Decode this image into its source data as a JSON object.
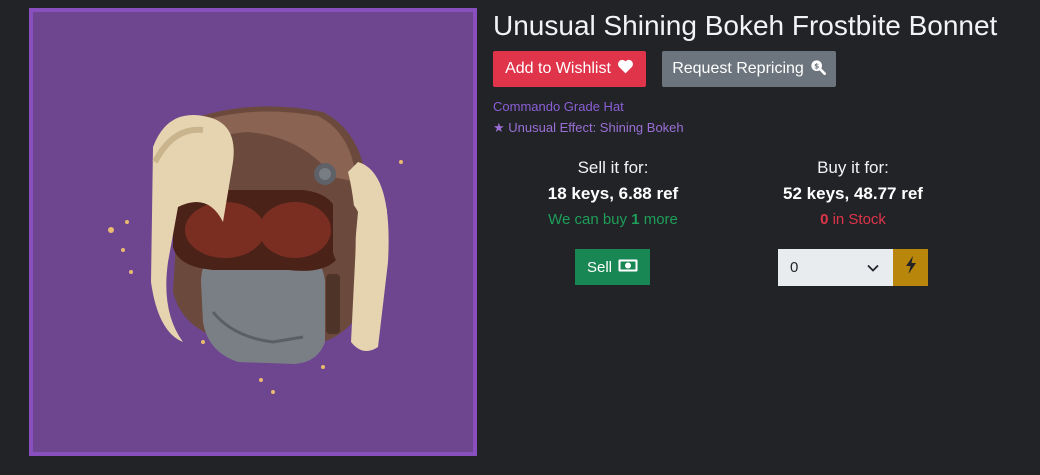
{
  "item": {
    "title": "Unusual Shining Bokeh Frostbite Bonnet",
    "grade": "Commando Grade Hat",
    "effect": "★ Unusual Effect: Shining Bokeh",
    "image_icon": "frostbite-bonnet-hat-image"
  },
  "actions": {
    "wishlist_label": "Add to Wishlist",
    "wishlist_icon": "heart-icon",
    "reprice_label": "Request Repricing",
    "reprice_icon": "search-dollar-icon"
  },
  "sell": {
    "label": "Sell it for:",
    "price": "18 keys, 6.88 ref",
    "note_prefix": "We can buy ",
    "note_count": "1",
    "note_suffix": " more",
    "button_label": "Sell",
    "button_icon": "money-bill-icon"
  },
  "buy": {
    "label": "Buy it for:",
    "price": "52 keys, 48.77 ref",
    "stock_count": "0",
    "stock_suffix": " in Stock",
    "quantity_value": "0",
    "bolt_icon": "bolt-icon"
  },
  "colors": {
    "background": "#212326",
    "wishlist": "#e0344a",
    "reprice": "#6c757d",
    "sell": "#198754",
    "bolt": "#b8860b",
    "frame_border": "#8a4fbf",
    "frame_bg": "#6e4690",
    "unusual_text": "#8b5fd6"
  }
}
